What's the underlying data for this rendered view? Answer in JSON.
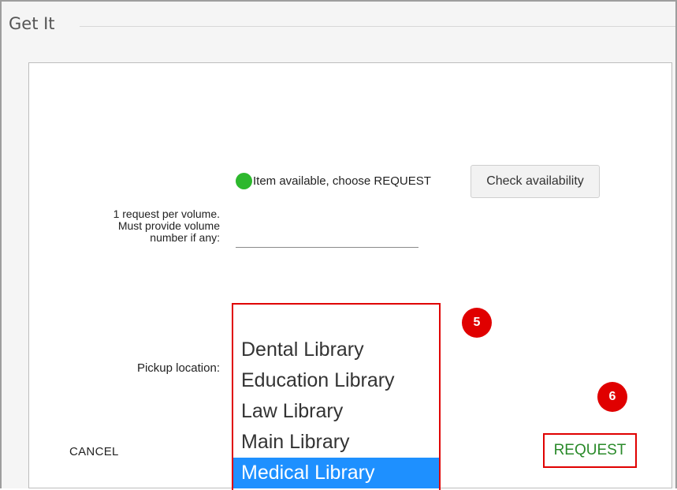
{
  "section": {
    "title": "Get It"
  },
  "availability": {
    "status_text": "Item available, choose REQUEST",
    "status_color": "#2db82d",
    "check_button_label": "Check availability"
  },
  "volume": {
    "label_lines": [
      "1 request per volume.",
      "Must provide volume",
      "number if any:"
    ],
    "value": ""
  },
  "pickup": {
    "label": "Pickup location:",
    "options": [
      {
        "label": "Dental Library",
        "selected": false
      },
      {
        "label": "Education Library",
        "selected": false
      },
      {
        "label": "Law Library",
        "selected": false
      },
      {
        "label": "Main Library",
        "selected": false
      },
      {
        "label": "Medical Library",
        "selected": true
      }
    ],
    "selected_color": "#1e90ff"
  },
  "annotations": {
    "badge_5": "5",
    "badge_6": "6",
    "highlight_color": "#e00000"
  },
  "actions": {
    "cancel_label": "CANCEL",
    "request_label": "REQUEST",
    "request_color": "#2a8a2a"
  }
}
